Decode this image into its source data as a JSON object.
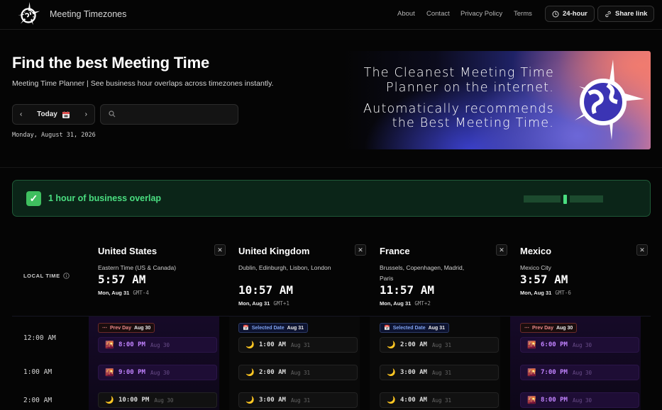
{
  "nav": {
    "brand": "Meeting Timezones",
    "links": [
      "About",
      "Contact",
      "Privacy Policy",
      "Terms"
    ],
    "hour_toggle": "24-hour",
    "share": "Share link"
  },
  "hero": {
    "title": "Find the best Meeting Time",
    "subtitle": "Meeting Time Planner | See business hour overlaps across timezones instantly.",
    "today_label": "Today",
    "search_placeholder": "",
    "date_text": "Monday, August 31, 2026",
    "banner": {
      "line1": "The Cleanest Meeting Time",
      "line2": "Planner on the internet.",
      "line3": "Automatically recommends",
      "line4": "the Best Meeting Time."
    }
  },
  "overlap": {
    "text": "1 hour of business overlap",
    "check": "✓",
    "total_hours": 24,
    "overlap_hour_index": 12,
    "color": "#4ade80"
  },
  "local_time_label": "LOCAL TIME",
  "timezones": [
    {
      "country": "United States",
      "region": "Eastern Time (US & Canada)",
      "time": "5:57 AM",
      "date": "Mon, Aug 31",
      "gmt": "GMT-4"
    },
    {
      "country": "United Kingdom",
      "region": "Dublin, Edinburgh, Lisbon, London",
      "time": "10:57 AM",
      "date": "Mon, Aug 31",
      "gmt": "GMT+1"
    },
    {
      "country": "France",
      "region": "Brussels, Copenhagen, Madrid, Paris",
      "time": "11:57 AM",
      "date": "Mon, Aug 31",
      "gmt": "GMT+2"
    },
    {
      "country": "Mexico",
      "region": "Mexico City",
      "time": "3:57 AM",
      "date": "Mon, Aug 31",
      "gmt": "GMT-6"
    }
  ],
  "tags": [
    {
      "label": "Prev Day",
      "date": "Aug 30",
      "kind": "prev"
    },
    {
      "label": "Selected Date",
      "date": "Aug 31",
      "kind": "sel"
    },
    {
      "label": "Selected Date",
      "date": "Aug 31",
      "kind": "sel"
    },
    {
      "label": "Prev Day",
      "date": "Aug 30",
      "kind": "prev"
    }
  ],
  "rows": [
    {
      "local": "12:00 AM",
      "cells": [
        {
          "time": "8:00 PM",
          "date": "Aug 30",
          "kind": "eve"
        },
        {
          "time": "1:00 AM",
          "date": "Aug 31",
          "kind": "night"
        },
        {
          "time": "2:00 AM",
          "date": "Aug 31",
          "kind": "night"
        },
        {
          "time": "6:00 PM",
          "date": "Aug 30",
          "kind": "eve"
        }
      ]
    },
    {
      "local": "1:00 AM",
      "cells": [
        {
          "time": "9:00 PM",
          "date": "Aug 30",
          "kind": "eve"
        },
        {
          "time": "2:00 AM",
          "date": "Aug 31",
          "kind": "night"
        },
        {
          "time": "3:00 AM",
          "date": "Aug 31",
          "kind": "night"
        },
        {
          "time": "7:00 PM",
          "date": "Aug 30",
          "kind": "eve"
        }
      ]
    },
    {
      "local": "2:00 AM",
      "cells": [
        {
          "time": "10:00 PM",
          "date": "Aug 30",
          "kind": "night"
        },
        {
          "time": "3:00 AM",
          "date": "Aug 31",
          "kind": "night"
        },
        {
          "time": "4:00 AM",
          "date": "Aug 31",
          "kind": "night"
        },
        {
          "time": "8:00 PM",
          "date": "Aug 30",
          "kind": "eve"
        }
      ]
    }
  ]
}
